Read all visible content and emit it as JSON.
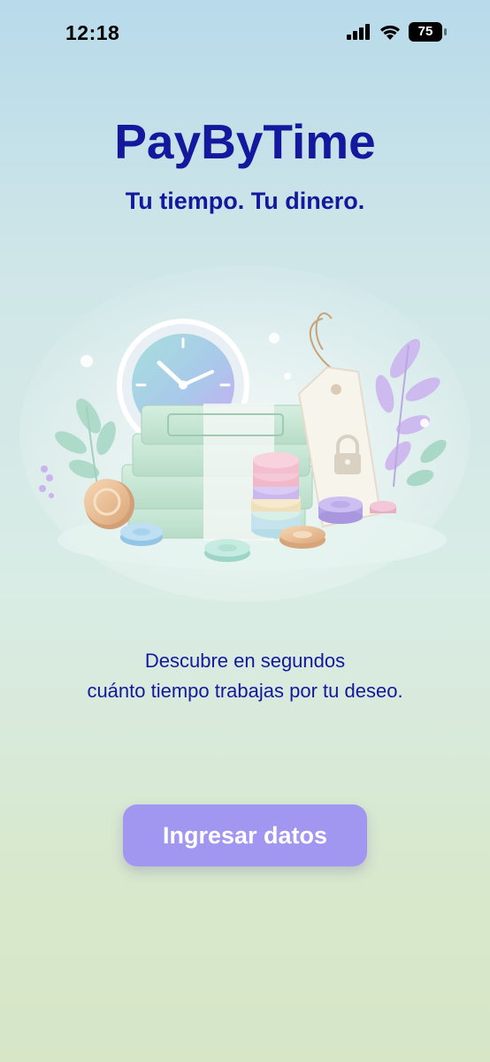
{
  "status_bar": {
    "time": "12:18",
    "battery_level": "75",
    "icons": [
      "signal-icon",
      "wifi-icon",
      "battery-icon"
    ]
  },
  "app": {
    "title": "PayByTime",
    "tagline": "Tu tiempo. Tu dinero."
  },
  "hero": {
    "illustration": "clock-money-price-tag-illustration"
  },
  "description": {
    "line1": "Descubre en segundos",
    "line2": "cuánto tiempo trabajas por tu deseo."
  },
  "cta": {
    "label": "Ingresar datos"
  },
  "colors": {
    "brand_text": "#13189c",
    "button": "#a196f0",
    "button_text": "#ffffff"
  }
}
